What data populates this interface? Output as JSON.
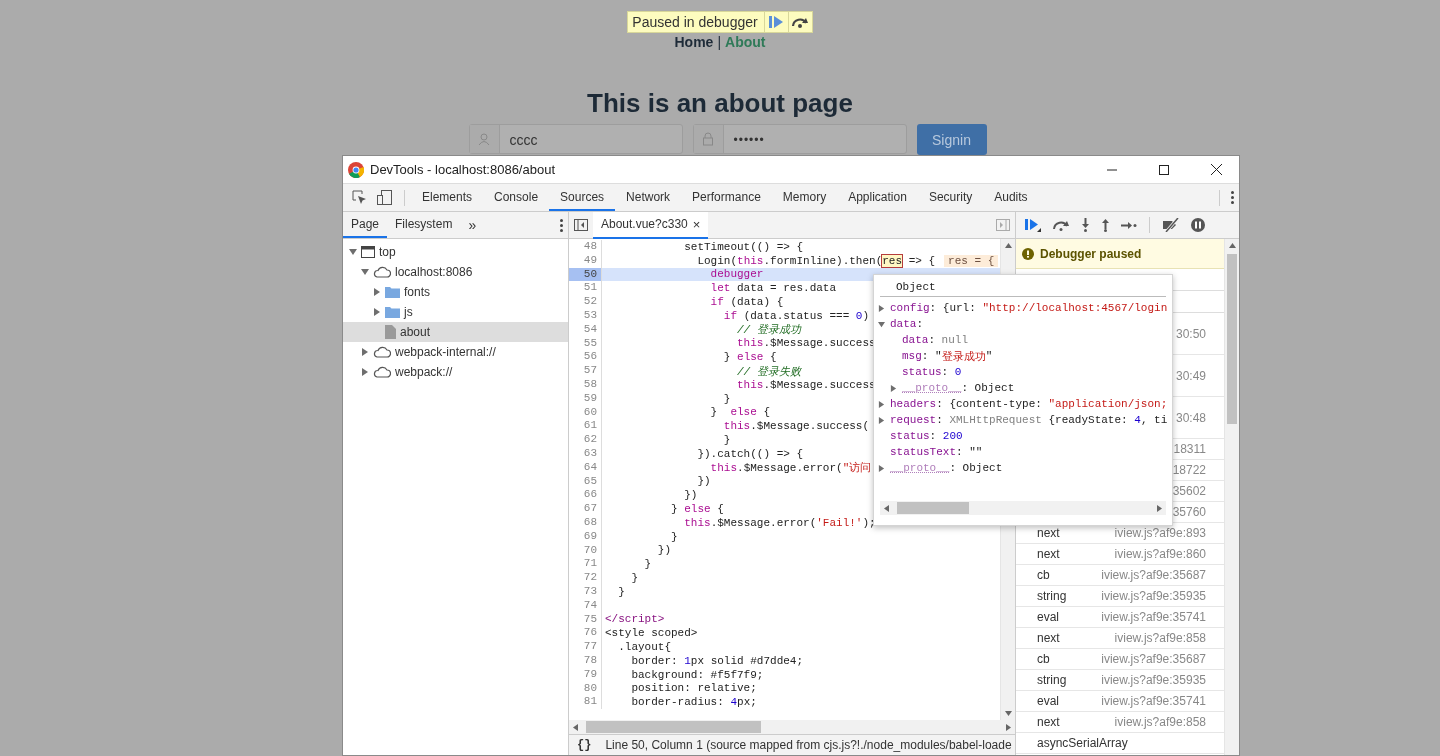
{
  "paused_banner": {
    "label": "Paused in debugger"
  },
  "nav": [
    {
      "label": "Home",
      "selected": false
    },
    {
      "label": "About",
      "selected": true
    }
  ],
  "nav_separator": "|",
  "heading": "This is an about page",
  "login_form": {
    "username": "cccc",
    "password": "••••••",
    "button": "Signin"
  },
  "devtools": {
    "title": "DevTools - localhost:8086/about",
    "tabs": [
      {
        "label": "Elements",
        "selected": false
      },
      {
        "label": "Console",
        "selected": false
      },
      {
        "label": "Sources",
        "selected": true
      },
      {
        "label": "Network",
        "selected": false
      },
      {
        "label": "Performance",
        "selected": false
      },
      {
        "label": "Memory",
        "selected": false
      },
      {
        "label": "Application",
        "selected": false
      },
      {
        "label": "Security",
        "selected": false
      },
      {
        "label": "Audits",
        "selected": false
      }
    ],
    "navigator_tabs": [
      {
        "label": "Page",
        "selected": true
      },
      {
        "label": "Filesystem",
        "selected": false
      }
    ],
    "more_tabs": "»",
    "tree": [
      {
        "label": "top",
        "kind": "frame",
        "expanded": true,
        "selected": false,
        "children": [
          {
            "label": "localhost:8086",
            "kind": "cloud",
            "expanded": true,
            "selected": false,
            "children": [
              {
                "label": "fonts",
                "kind": "folder",
                "expanded": false,
                "selected": false
              },
              {
                "label": "js",
                "kind": "folder",
                "expanded": false,
                "selected": false
              },
              {
                "label": "about",
                "kind": "file",
                "selected": true
              }
            ]
          },
          {
            "label": "webpack-internal://",
            "kind": "cloud",
            "expanded": false,
            "selected": false
          },
          {
            "label": "webpack://",
            "kind": "cloud",
            "expanded": false,
            "selected": false
          }
        ]
      }
    ],
    "editor_tab": {
      "label": "About.vue?c330",
      "close": "×",
      "selected": true
    },
    "code_lines": [
      {
        "number": "48",
        "current": false,
        "tokens": [
          {
            "kind": "plain",
            "text": "            setTimeout(() => {"
          }
        ]
      },
      {
        "number": "49",
        "current": false,
        "inline_value": "res = {",
        "tokens": [
          {
            "kind": "plain",
            "text": "              Login("
          },
          {
            "kind": "keyword",
            "text": "this"
          },
          {
            "kind": "plain",
            "text": ".formInline).then("
          },
          {
            "kind": "boxed",
            "text": "res"
          },
          {
            "kind": "plain",
            "text": " => {"
          }
        ]
      },
      {
        "number": "50",
        "current": true,
        "tokens": [
          {
            "kind": "keyword",
            "text": "                debugger"
          }
        ]
      },
      {
        "number": "51",
        "current": false,
        "tokens": [
          {
            "kind": "keyword",
            "text": "                let"
          },
          {
            "kind": "plain",
            "text": " data = res.data"
          }
        ]
      },
      {
        "number": "52",
        "current": false,
        "tokens": [
          {
            "kind": "keyword",
            "text": "                if"
          },
          {
            "kind": "plain",
            "text": " (data) {"
          }
        ]
      },
      {
        "number": "53",
        "current": false,
        "tokens": [
          {
            "kind": "keyword",
            "text": "                  if"
          },
          {
            "kind": "plain",
            "text": " (data.status === "
          },
          {
            "kind": "number",
            "text": "0"
          },
          {
            "kind": "plain",
            "text": ")"
          }
        ]
      },
      {
        "number": "54",
        "current": false,
        "tokens": [
          {
            "kind": "comment",
            "text": "                    // 登录成功"
          }
        ]
      },
      {
        "number": "55",
        "current": false,
        "tokens": [
          {
            "kind": "keyword",
            "text": "                    this"
          },
          {
            "kind": "plain",
            "text": ".$Message.success"
          }
        ]
      },
      {
        "number": "56",
        "current": false,
        "tokens": [
          {
            "kind": "plain",
            "text": "                  } "
          },
          {
            "kind": "keyword",
            "text": "else"
          },
          {
            "kind": "plain",
            "text": " {"
          }
        ]
      },
      {
        "number": "57",
        "current": false,
        "tokens": [
          {
            "kind": "comment",
            "text": "                    // 登录失败"
          }
        ]
      },
      {
        "number": "58",
        "current": false,
        "tokens": [
          {
            "kind": "keyword",
            "text": "                    this"
          },
          {
            "kind": "plain",
            "text": ".$Message.success"
          }
        ]
      },
      {
        "number": "59",
        "current": false,
        "tokens": [
          {
            "kind": "plain",
            "text": "                  }"
          }
        ]
      },
      {
        "number": "60",
        "current": false,
        "tokens": [
          {
            "kind": "plain",
            "text": "                }  "
          },
          {
            "kind": "keyword",
            "text": "else"
          },
          {
            "kind": "plain",
            "text": " {"
          }
        ]
      },
      {
        "number": "61",
        "current": false,
        "tokens": [
          {
            "kind": "keyword",
            "text": "                  this"
          },
          {
            "kind": "plain",
            "text": ".$Message.success("
          }
        ]
      },
      {
        "number": "62",
        "current": false,
        "tokens": [
          {
            "kind": "plain",
            "text": "                  }"
          }
        ]
      },
      {
        "number": "63",
        "current": false,
        "tokens": [
          {
            "kind": "plain",
            "text": "              }).catch(() => {"
          }
        ]
      },
      {
        "number": "64",
        "current": false,
        "tokens": [
          {
            "kind": "keyword",
            "text": "                this"
          },
          {
            "kind": "plain",
            "text": ".$Message.error("
          },
          {
            "kind": "string",
            "text": "\"访问"
          }
        ]
      },
      {
        "number": "65",
        "current": false,
        "tokens": [
          {
            "kind": "plain",
            "text": "              })"
          }
        ]
      },
      {
        "number": "66",
        "current": false,
        "tokens": [
          {
            "kind": "plain",
            "text": "            })"
          }
        ]
      },
      {
        "number": "67",
        "current": false,
        "tokens": [
          {
            "kind": "plain",
            "text": "          } "
          },
          {
            "kind": "keyword",
            "text": "else"
          },
          {
            "kind": "plain",
            "text": " {"
          }
        ]
      },
      {
        "number": "68",
        "current": false,
        "tokens": [
          {
            "kind": "keyword",
            "text": "            this"
          },
          {
            "kind": "plain",
            "text": ".$Message.error("
          },
          {
            "kind": "string",
            "text": "'Fail!'"
          },
          {
            "kind": "plain",
            "text": ");"
          }
        ]
      },
      {
        "number": "69",
        "current": false,
        "tokens": [
          {
            "kind": "plain",
            "text": "          }"
          }
        ]
      },
      {
        "number": "70",
        "current": false,
        "tokens": [
          {
            "kind": "plain",
            "text": "        })"
          }
        ]
      },
      {
        "number": "71",
        "current": false,
        "tokens": [
          {
            "kind": "plain",
            "text": "      }"
          }
        ]
      },
      {
        "number": "72",
        "current": false,
        "tokens": [
          {
            "kind": "plain",
            "text": "    }"
          }
        ]
      },
      {
        "number": "73",
        "current": false,
        "tokens": [
          {
            "kind": "plain",
            "text": "  }"
          }
        ]
      },
      {
        "number": "74",
        "current": false
      },
      {
        "number": "75",
        "current": false,
        "tokens": [
          {
            "kind": "tag",
            "text": "</script>"
          }
        ]
      },
      {
        "number": "76",
        "current": false,
        "tokens": [
          {
            "kind": "plain",
            "text": "<style scoped>"
          }
        ]
      },
      {
        "number": "77",
        "current": false,
        "tokens": [
          {
            "kind": "plain",
            "text": "  .layout{"
          }
        ]
      },
      {
        "number": "78",
        "current": false,
        "tokens": [
          {
            "kind": "plain",
            "text": "    border: "
          },
          {
            "kind": "number",
            "text": "1"
          },
          {
            "kind": "plain",
            "text": "px solid #d7dde4;"
          }
        ]
      },
      {
        "number": "79",
        "current": false,
        "tokens": [
          {
            "kind": "plain",
            "text": "    background: #f5f7f9;"
          }
        ]
      },
      {
        "number": "80",
        "current": false,
        "tokens": [
          {
            "kind": "plain",
            "text": "    position: relative;"
          }
        ]
      },
      {
        "number": "81",
        "current": false,
        "tokens": [
          {
            "kind": "plain",
            "text": "    border-radius: "
          },
          {
            "kind": "number",
            "text": "4"
          },
          {
            "kind": "plain",
            "text": "px;"
          }
        ]
      }
    ],
    "status_bar": {
      "braces": "{}",
      "text": "Line 50, Column 1  (source mapped from cjs.js?!./node_modules/babel-loade"
    },
    "debugger_status": "Debugger paused",
    "call_stack": [
      {
        "kind": "tall",
        "location": "30:50"
      },
      {
        "kind": "tall",
        "location": "30:49"
      },
      {
        "kind": "tall",
        "location": "30:48"
      },
      {
        "kind": "row",
        "location": "18311"
      },
      {
        "kind": "row",
        "location": "18722"
      },
      {
        "kind": "row",
        "location": "35602"
      },
      {
        "kind": "row",
        "location": "35760"
      },
      {
        "kind": "row",
        "function": "next",
        "location": "iview.js?af9e:893"
      },
      {
        "kind": "row",
        "function": "next",
        "location": "iview.js?af9e:860"
      },
      {
        "kind": "row",
        "function": "cb",
        "location": "iview.js?af9e:35687"
      },
      {
        "kind": "row",
        "function": "string",
        "location": "iview.js?af9e:35935"
      },
      {
        "kind": "row",
        "function": "eval",
        "location": "iview.js?af9e:35741"
      },
      {
        "kind": "row",
        "function": "next",
        "location": "iview.js?af9e:858"
      },
      {
        "kind": "row",
        "function": "cb",
        "location": "iview.js?af9e:35687"
      },
      {
        "kind": "row",
        "function": "string",
        "location": "iview.js?af9e:35935"
      },
      {
        "kind": "row",
        "function": "eval",
        "location": "iview.js?af9e:35741"
      },
      {
        "kind": "row",
        "function": "next",
        "location": "iview.js?af9e:858"
      },
      {
        "kind": "row",
        "function": "asyncSerialArray"
      }
    ],
    "popup": {
      "title": "Object",
      "entries": [
        {
          "expanded": false,
          "tokens": [
            {
              "kind": "key",
              "text": "config"
            },
            {
              "kind": "plain",
              "text": ": {url: "
            },
            {
              "kind": "string",
              "text": "\"http://localhost:4567/login"
            }
          ]
        },
        {
          "expanded": true,
          "tokens": [
            {
              "kind": "key",
              "text": "data"
            },
            {
              "kind": "plain",
              "text": ":"
            }
          ],
          "children": [
            {
              "tokens": [
                {
                  "kind": "key",
                  "text": "data"
                },
                {
                  "kind": "plain",
                  "text": ": "
                },
                {
                  "kind": "dim",
                  "text": "null"
                }
              ]
            },
            {
              "tokens": [
                {
                  "kind": "key",
                  "text": "msg"
                },
                {
                  "kind": "plain",
                  "text": ": \""
                },
                {
                  "kind": "string",
                  "text": "登录成功"
                },
                {
                  "kind": "plain",
                  "text": "\""
                }
              ]
            },
            {
              "tokens": [
                {
                  "kind": "key",
                  "text": "status"
                },
                {
                  "kind": "plain",
                  "text": ": "
                },
                {
                  "kind": "number",
                  "text": "0"
                }
              ]
            },
            {
              "expanded": false,
              "tokens": [
                {
                  "kind": "proto",
                  "text": "__proto__"
                },
                {
                  "kind": "plain",
                  "text": ": Object"
                }
              ]
            }
          ]
        },
        {
          "expanded": false,
          "tokens": [
            {
              "kind": "key",
              "text": "headers"
            },
            {
              "kind": "plain",
              "text": ": {content-type: "
            },
            {
              "kind": "string",
              "text": "\"application/json;"
            }
          ]
        },
        {
          "expanded": false,
          "tokens": [
            {
              "kind": "key",
              "text": "request"
            },
            {
              "kind": "plain",
              "text": ": "
            },
            {
              "kind": "dim",
              "text": "XMLHttpRequest"
            },
            {
              "kind": "plain",
              "text": " {readyState: "
            },
            {
              "kind": "number",
              "text": "4"
            },
            {
              "kind": "plain",
              "text": ", ti"
            }
          ]
        },
        {
          "tokens": [
            {
              "kind": "key",
              "text": "status"
            },
            {
              "kind": "plain",
              "text": ": "
            },
            {
              "kind": "number",
              "text": "200"
            }
          ]
        },
        {
          "tokens": [
            {
              "kind": "key",
              "text": "statusText"
            },
            {
              "kind": "plain",
              "text": ": \"\""
            }
          ]
        },
        {
          "expanded": false,
          "tokens": [
            {
              "kind": "proto",
              "text": "__proto__"
            },
            {
              "kind": "plain",
              "text": ": Object"
            }
          ]
        }
      ]
    }
  }
}
